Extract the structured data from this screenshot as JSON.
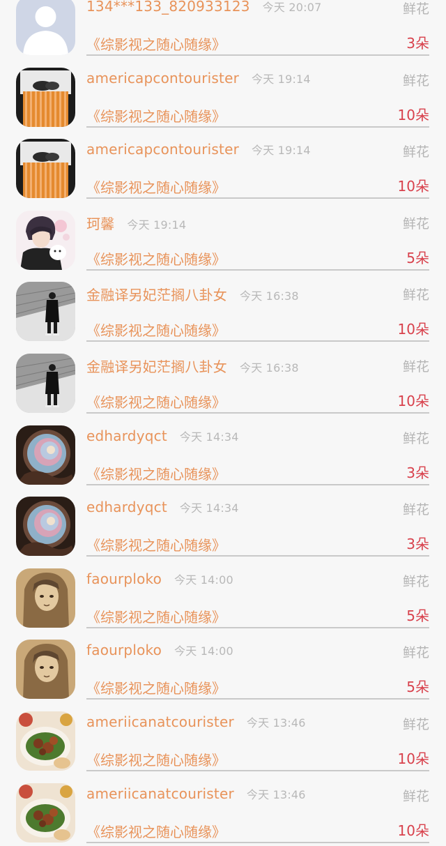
{
  "rows": [
    {
      "name": "134***133_820933123",
      "time": "今天 20:07",
      "gift": "鲜花",
      "title": "《综影视之随心随缘》",
      "count": "3朵",
      "avatar": "default-avatar-icon"
    },
    {
      "name": "americapcontourister",
      "time": "今天 19:14",
      "gift": "鲜花",
      "title": "《综影视之随心随缘》",
      "count": "10朵",
      "avatar": "striped-blanket-photo"
    },
    {
      "name": "americapcontourister",
      "time": "今天 19:14",
      "gift": "鲜花",
      "title": "《综影视之随心随缘》",
      "count": "10朵",
      "avatar": "striped-blanket-photo"
    },
    {
      "name": "珂馨",
      "time": "今天 19:14",
      "gift": "鲜花",
      "title": "《综影视之随心随缘》",
      "count": "5朵",
      "avatar": "anime-boy-illustration"
    },
    {
      "name": "金融译另妃茫搁八卦女",
      "time": "今天 16:38",
      "gift": "鲜花",
      "title": "《综影视之随心随缘》",
      "count": "10朵",
      "avatar": "street-photo-grayscale"
    },
    {
      "name": "金融译另妃茫搁八卦女",
      "time": "今天 16:38",
      "gift": "鲜花",
      "title": "《综影视之随心随缘》",
      "count": "10朵",
      "avatar": "street-photo-grayscale"
    },
    {
      "name": "edhardyqct",
      "time": "今天 14:34",
      "gift": "鲜花",
      "title": "《综影视之随心随缘》",
      "count": "3朵",
      "avatar": "shell-photo"
    },
    {
      "name": "edhardyqct",
      "time": "今天 14:34",
      "gift": "鲜花",
      "title": "《综影视之随心随缘》",
      "count": "3朵",
      "avatar": "shell-photo"
    },
    {
      "name": "faourploko",
      "time": "今天 14:00",
      "gift": "鲜花",
      "title": "《综影视之随心随缘》",
      "count": "5朵",
      "avatar": "sepia-girl-sketch"
    },
    {
      "name": "faourploko",
      "time": "今天 14:00",
      "gift": "鲜花",
      "title": "《综影视之随心随缘》",
      "count": "5朵",
      "avatar": "sepia-girl-sketch"
    },
    {
      "name": "ameriicanatcourister",
      "time": "今天 13:46",
      "gift": "鲜花",
      "title": "《综影视之随心随缘》",
      "count": "10朵",
      "avatar": "food-plate-photo"
    },
    {
      "name": "ameriicanatcourister",
      "time": "今天 13:46",
      "gift": "鲜花",
      "title": "《综影视之随心随缘》",
      "count": "10朵",
      "avatar": "food-plate-photo"
    }
  ],
  "colors": {
    "name": "#e8935a",
    "time": "#b8b8b8",
    "gift": "#b5b5b5",
    "count": "#d8414c",
    "divider": "#c9c9c9",
    "background": "#f7f7f7"
  }
}
